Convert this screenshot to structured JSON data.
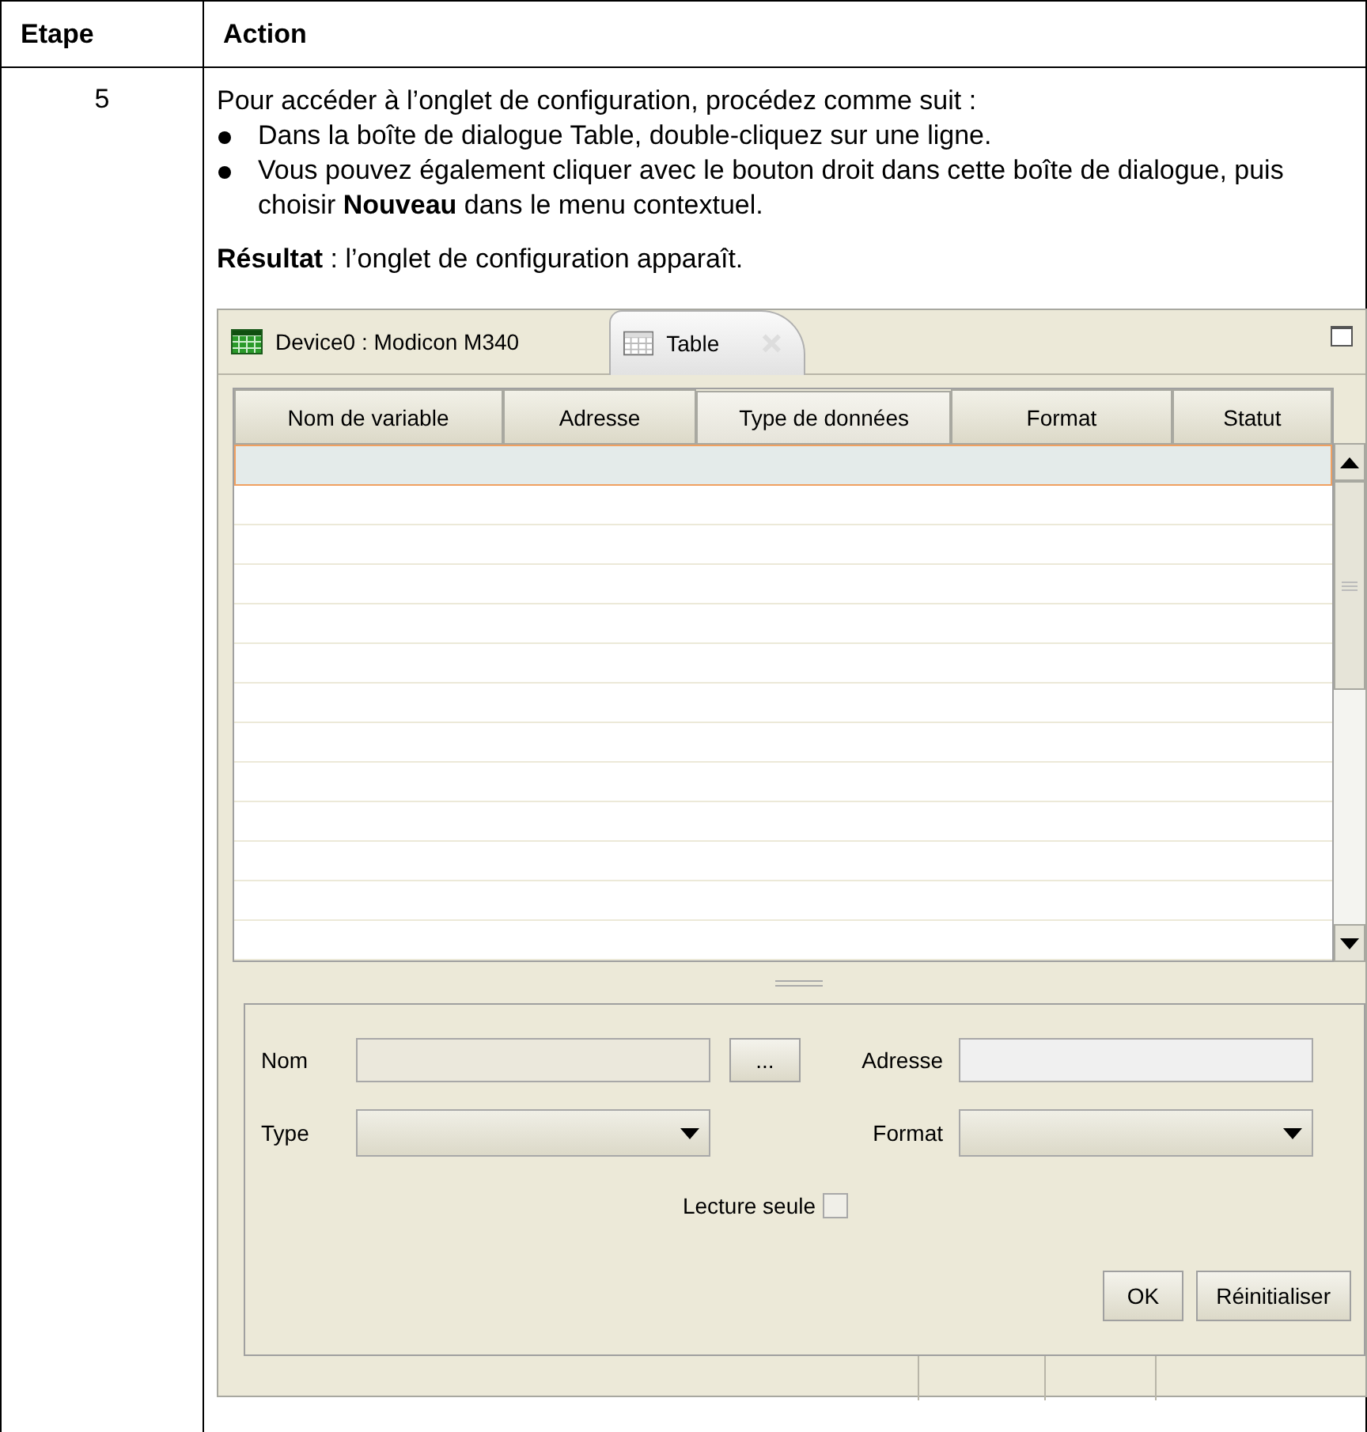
{
  "table": {
    "columns": [
      "Etape",
      "Action"
    ],
    "rows": [
      {
        "step": "5",
        "intro": "Pour accéder à l’onglet de configuration, procédez comme suit :",
        "bullets": [
          "Dans la boîte de dialogue Table, double-cliquez sur une ligne.",
          "Vous pouvez également cliquer avec le bouton droit dans cette boîte de dialogue, puis choisir **Nouveau** dans le menu contextuel."
        ],
        "result": "**Résultat** : l’onglet de configuration apparaît.",
        "screenshot": {
          "tabs": [
            {
              "label": "Device0 : Modicon M340",
              "selected": false,
              "closable": false
            },
            {
              "label": "Table",
              "selected": true,
              "closable": true
            }
          ],
          "grid": {
            "columns": [
              {
                "label": "Nom de variable",
                "pressed": false
              },
              {
                "label": "Adresse",
                "pressed": false
              },
              {
                "label": "Type de données",
                "pressed": true
              },
              {
                "label": "Format",
                "pressed": false
              },
              {
                "label": "Statut",
                "pressed": false
              }
            ],
            "rows": [
              {
                "selected": true
              },
              {
                "selected": false
              },
              {
                "selected": false
              },
              {
                "selected": false
              },
              {
                "selected": false
              },
              {
                "selected": false
              },
              {
                "selected": false
              },
              {
                "selected": false
              },
              {
                "selected": false
              },
              {
                "selected": false
              },
              {
                "selected": false
              },
              {
                "selected": false
              },
              {
                "selected": false
              }
            ]
          },
          "form": {
            "name_label": "Nom",
            "browse_button": "...",
            "address_label": "Adresse",
            "type_label": "Type",
            "format_label": "Format",
            "readonly": {
              "label": "Lecture seule",
              "checked": false
            },
            "buttons": [
              "OK",
              "Réinitialiser"
            ]
          }
        }
      }
    ]
  }
}
